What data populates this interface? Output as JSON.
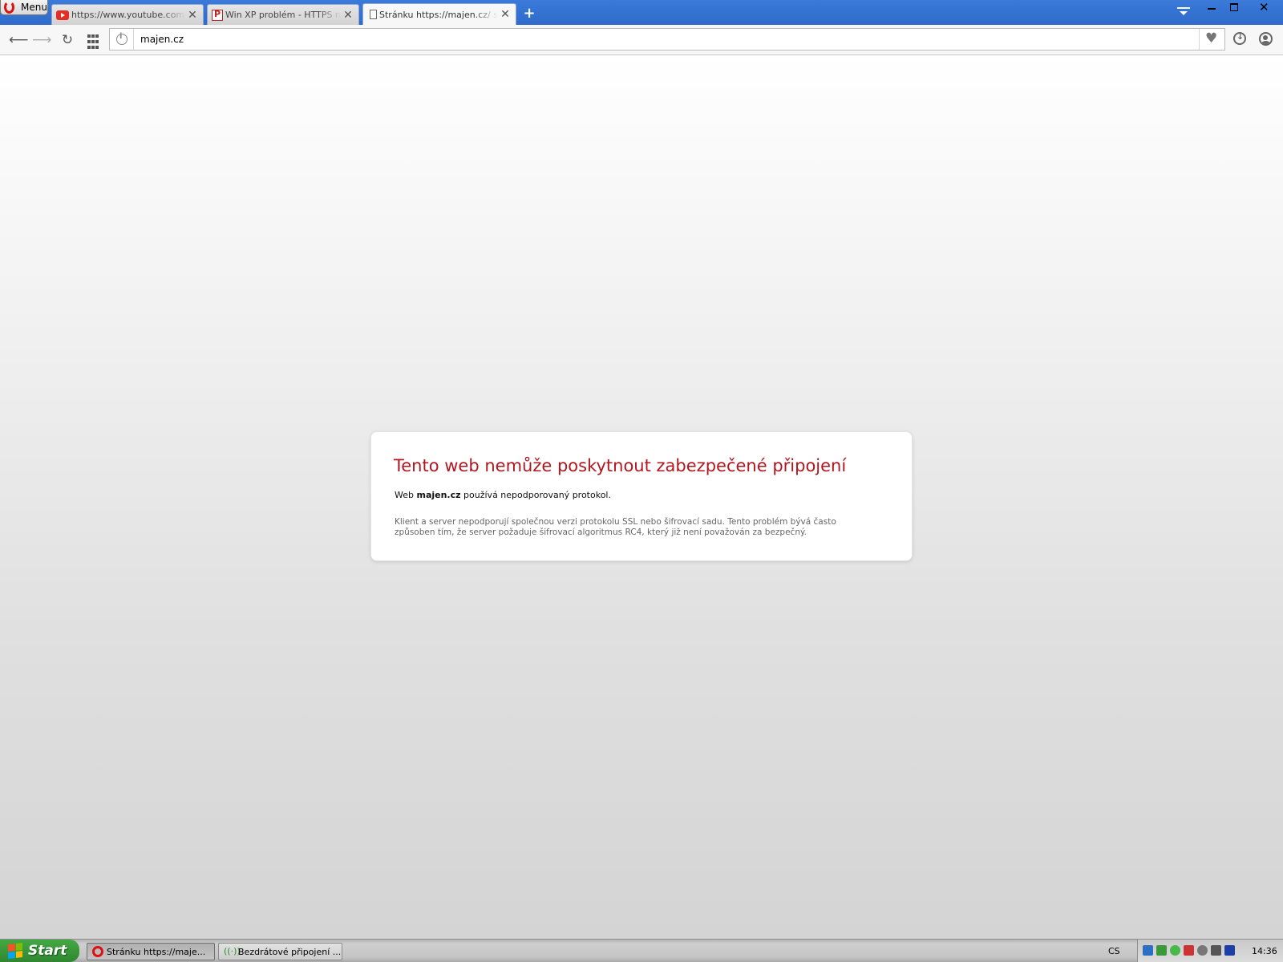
{
  "browser": {
    "menu_label": "Menu",
    "tabs": [
      {
        "title": "https://www.youtube.com/watch",
        "icon": "youtube-icon",
        "active": false
      },
      {
        "title": "Win XP problém - HTTPS nefunguje",
        "icon": "pcret-icon",
        "active": false
      },
      {
        "title": "Stránku https://majen.cz/ se nepodařilo načíst",
        "icon": "document-icon",
        "active": true
      }
    ],
    "new_tab_label": "+",
    "address": {
      "url": "majen.cz"
    }
  },
  "error_page": {
    "title": "Tento web nemůže poskytnout zabezpečené připojení",
    "line_prefix": "Web ",
    "line_domain": "majen.cz",
    "line_suffix": " používá nepodporovaný protokol.",
    "detail": "Klient a server nepodporují společnou verzi protokolu SSL nebo šifrovací sadu. Tento problém bývá často způsoben tím, že server požaduje šifrovací algoritmus RC4, který již není považován za bezpečný.",
    "title_color": "#b3161f"
  },
  "taskbar": {
    "start_label": "Start",
    "items": [
      {
        "label": "Stránku https://maje...",
        "icon": "opera-icon",
        "active": true
      },
      {
        "label": "Bezdrátové připojení ...",
        "icon": "wireless-icon",
        "active": false
      }
    ],
    "language": "CS",
    "clock": "14:36"
  }
}
